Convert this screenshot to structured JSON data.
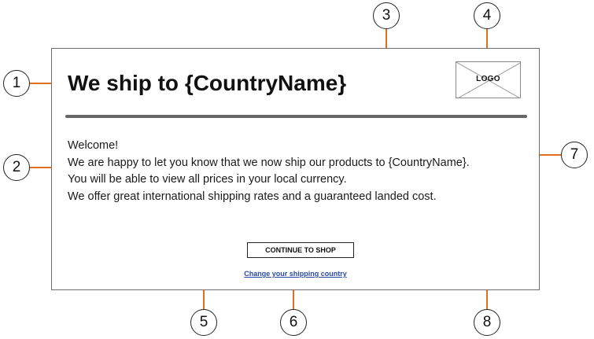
{
  "popup": {
    "title": "We ship to {CountryName}",
    "logo_label": "LOGO",
    "message_lines": [
      "Welcome!",
      "We are happy to let you know that we now ship our products to {CountryName}.",
      "You will be able to view all prices in your local currency.",
      "We offer great international shipping rates and a guaranteed landed cost."
    ],
    "continue_button": "CONTINUE TO SHOP",
    "change_country_link": "Change your shipping country"
  },
  "callouts": [
    "1",
    "2",
    "3",
    "4",
    "5",
    "6",
    "7",
    "8"
  ],
  "colors": {
    "callout_line": "#e07020",
    "link": "#2a4aa8",
    "divider": "#666666"
  }
}
